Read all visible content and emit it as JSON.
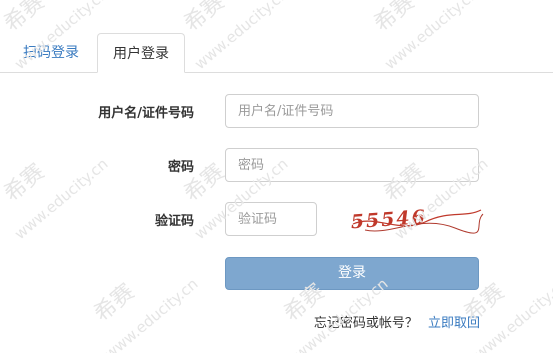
{
  "tabs": {
    "scan_label": "扫码登录",
    "user_label": "用户登录"
  },
  "form": {
    "username_label": "用户名/证件号码",
    "username_placeholder": "用户名/证件号码",
    "password_label": "密码",
    "password_placeholder": "密码",
    "captcha_label": "验证码",
    "captcha_placeholder": "验证码",
    "captcha_text": "55546",
    "login_label": "登录"
  },
  "footer": {
    "forgot_text": "忘记密码或帐号？",
    "retrieve_link": "立即取回"
  },
  "colors": {
    "accent": "#3a7bc0",
    "button": "#7ea7cf",
    "captcha": "#c0392b"
  }
}
